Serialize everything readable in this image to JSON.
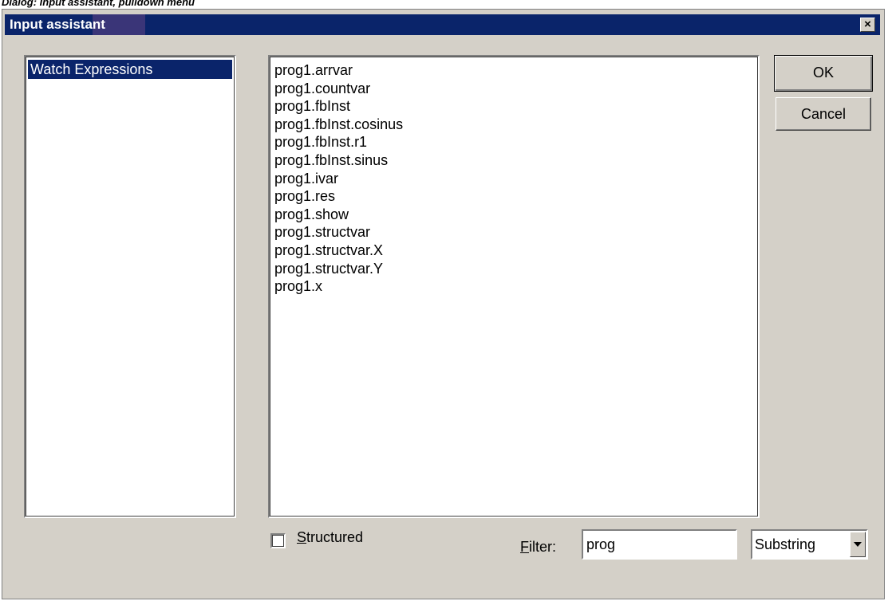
{
  "caption": "Dialog: Input assistant, pulldown menu",
  "window": {
    "title": "Input assistant",
    "close_label": "×"
  },
  "categories": {
    "items": [
      {
        "label": "Watch Expressions",
        "selected": true
      }
    ]
  },
  "expressions": {
    "items": [
      "prog1.arrvar",
      "prog1.countvar",
      "prog1.fbInst",
      "prog1.fbInst.cosinus",
      "prog1.fbInst.r1",
      "prog1.fbInst.sinus",
      "prog1.ivar",
      "prog1.res",
      "prog1.show",
      "prog1.structvar",
      "prog1.structvar.X",
      "prog1.structvar.Y",
      "prog1.x"
    ]
  },
  "buttons": {
    "ok_label": "OK",
    "cancel_label": "Cancel"
  },
  "structured": {
    "mnemonic": "S",
    "rest": "tructured",
    "checked": false
  },
  "filter": {
    "mnemonic": "F",
    "rest": "ilter:",
    "value": "prog"
  },
  "match_mode": {
    "selected": "Substring"
  },
  "colors": {
    "titlebar": "#0a246a",
    "dialog_bg": "#d4d0c8",
    "selection": "#0a246a"
  },
  "icons": {
    "close": "close-icon",
    "dropdown": "chevron-down-icon"
  }
}
